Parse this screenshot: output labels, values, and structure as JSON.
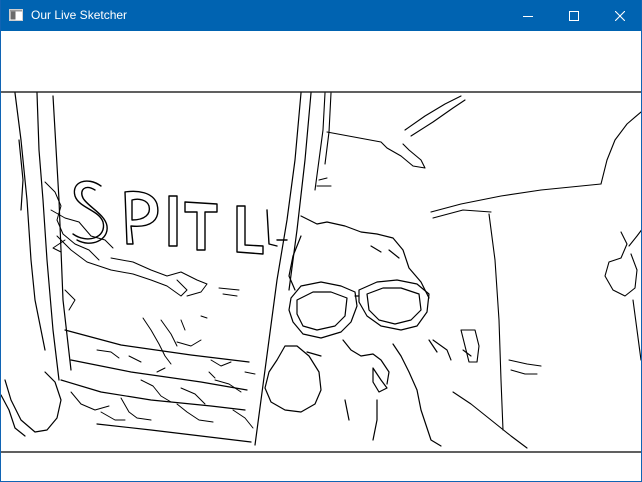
{
  "window": {
    "title": "Our Live Sketcher",
    "titlebar_color": "#0063b1",
    "icons": {
      "app": "window-app-icon",
      "minimize": "minimize-icon",
      "maximize": "maximize-icon",
      "close": "close-icon"
    }
  },
  "canvas": {
    "content": "edge-detection sketch of webcam frame",
    "background": "#ffffff",
    "stroke": "#000000"
  }
}
